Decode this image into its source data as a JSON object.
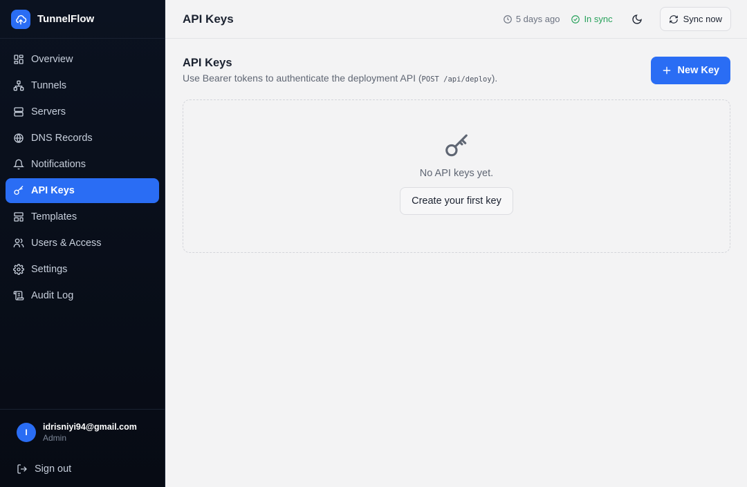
{
  "brand": {
    "name": "TunnelFlow",
    "logo_icon": "cloud-upload-icon"
  },
  "sidebar": {
    "items": [
      {
        "label": "Overview",
        "icon": "grid-icon"
      },
      {
        "label": "Tunnels",
        "icon": "network-icon"
      },
      {
        "label": "Servers",
        "icon": "server-icon"
      },
      {
        "label": "DNS Records",
        "icon": "globe-icon"
      },
      {
        "label": "Notifications",
        "icon": "bell-icon"
      },
      {
        "label": "API Keys",
        "icon": "key-icon",
        "active": true
      },
      {
        "label": "Templates",
        "icon": "layout-icon"
      },
      {
        "label": "Users & Access",
        "icon": "users-icon"
      },
      {
        "label": "Settings",
        "icon": "gear-icon"
      },
      {
        "label": "Audit Log",
        "icon": "scroll-icon"
      }
    ]
  },
  "user": {
    "initial": "I",
    "email": "idrisniyi94@gmail.com",
    "role": "Admin"
  },
  "signout": {
    "label": "Sign out"
  },
  "topbar": {
    "title": "API Keys",
    "last_sync": "5 days ago",
    "status": "In sync",
    "sync_button": "Sync now"
  },
  "section": {
    "title": "API Keys",
    "subtitle_prefix": "Use Bearer tokens to authenticate the deployment API (",
    "subtitle_code": "POST /api/deploy",
    "subtitle_suffix": ").",
    "new_key_button": "New Key"
  },
  "empty_state": {
    "message": "No API keys yet.",
    "create_button": "Create your first key"
  },
  "colors": {
    "accent": "#2a6df4",
    "sidebar_bg": "#0b1220",
    "success": "#27a15a"
  }
}
